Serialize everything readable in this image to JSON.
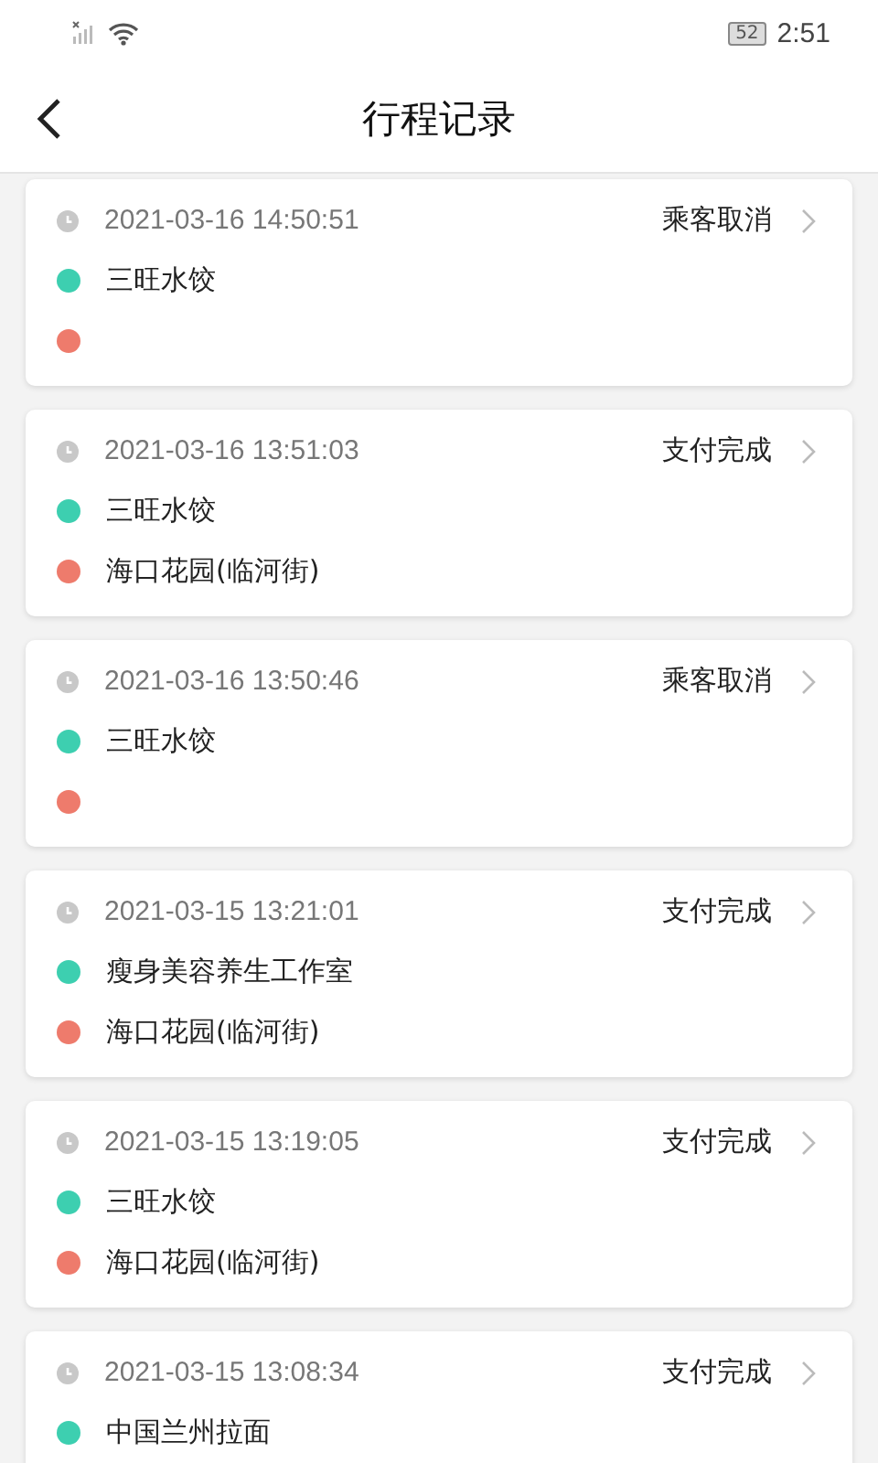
{
  "status_bar": {
    "battery": "52",
    "time": "2:51"
  },
  "header": {
    "title": "行程记录"
  },
  "trips": [
    {
      "time": "2021-03-16 14:50:51",
      "status": "乘客取消",
      "stops": [
        {
          "kind": "start",
          "place": "三旺水饺"
        },
        {
          "kind": "end"
        }
      ]
    },
    {
      "time": "2021-03-16 13:51:03",
      "status": "支付完成",
      "stops": [
        {
          "kind": "start",
          "place": "三旺水饺"
        },
        {
          "kind": "end",
          "place": "海口花园(临河街)"
        }
      ]
    },
    {
      "time": "2021-03-16 13:50:46",
      "status": "乘客取消",
      "stops": [
        {
          "kind": "start",
          "place": "三旺水饺"
        },
        {
          "kind": "end"
        }
      ]
    },
    {
      "time": "2021-03-15 13:21:01",
      "status": "支付完成",
      "stops": [
        {
          "kind": "start",
          "place": "瘦身美容养生工作室"
        },
        {
          "kind": "end",
          "place": "海口花园(临河街)"
        }
      ]
    },
    {
      "time": "2021-03-15 13:19:05",
      "status": "支付完成",
      "stops": [
        {
          "kind": "start",
          "place": "三旺水饺"
        },
        {
          "kind": "end",
          "place": "海口花园(临河街)"
        }
      ]
    },
    {
      "time": "2021-03-15 13:08:34",
      "status": "支付完成",
      "stops": [
        {
          "kind": "start",
          "place": "中国兰州拉面"
        }
      ]
    }
  ]
}
